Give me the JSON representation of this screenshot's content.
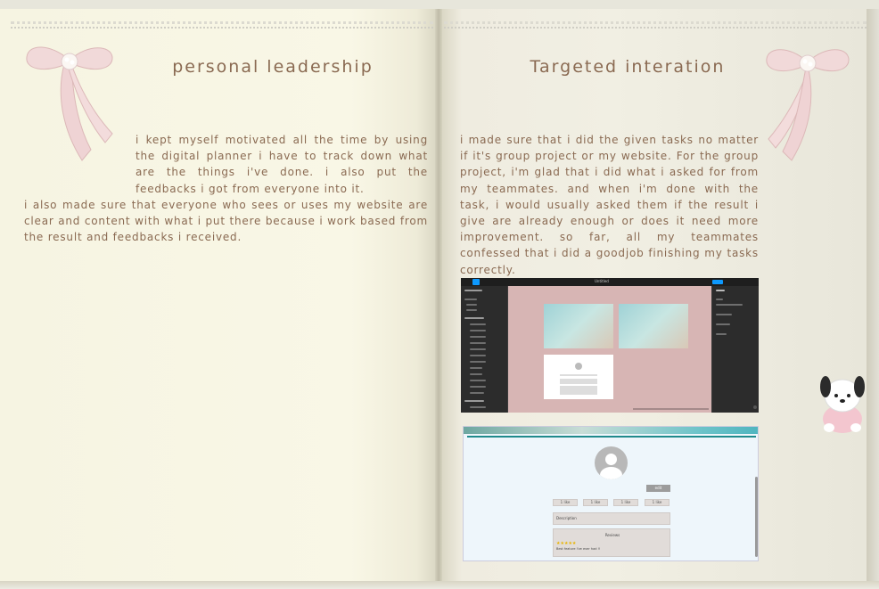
{
  "left_page": {
    "title": "personal leadership",
    "para1": "i kept myself motivated all the time by using the digital planner i have to track down what are the things i've done. i also put the feedbacks i got from everyone into it.",
    "para2": "i also made sure that everyone who sees or uses my website are clear and content with what i put there because i work based from the result and feedbacks i received."
  },
  "right_page": {
    "title": "Targeted interation",
    "para1": "i made sure that i did the given tasks no matter if it's group project or my website. For the group project, i'm glad that i did what i asked for from my teammates. and when i'm done with the task, i would usually asked them if the result i give are already enough or does it need more improvement. so far, all my teammates confessed that i did a goodjob finishing my tasks correctly."
  },
  "figma_screenshot": {
    "file_name": "Untitled",
    "left_panel_header": "Layers",
    "layers": [
      "Page 1",
      "Page 2",
      "Desktop - 1",
      "Rectangle",
      "Rectangle",
      "Rectangle",
      "Rectangle",
      "Rectangle",
      "Ellipse",
      "Group",
      "Rectangle",
      "Desktop - 2",
      "Rectangle"
    ],
    "frame_labels": [
      "Desktop - 1",
      "Desktop - 2",
      "Desktop - 3"
    ],
    "frame1_heading": "HELP",
    "frame2_heading": "MISSIONS",
    "right_panel_header": "Design",
    "right_panel_items": [
      "Page",
      "Local variables",
      "Local styles",
      "Export"
    ],
    "share_label": "Share"
  },
  "website_screenshot": {
    "edit_button": "edit",
    "likes": [
      "1 like",
      "1 like",
      "1 like",
      "1 like"
    ],
    "description": "Description",
    "review_title": "Reviews",
    "stars": "★★★★★",
    "review_text": "Best feature I've ever had !!"
  },
  "colors": {
    "text": "#8a6a52",
    "page": "#f6f4e2",
    "bow": "#f0d7d7",
    "figma_canvas": "#d7b5b4"
  }
}
